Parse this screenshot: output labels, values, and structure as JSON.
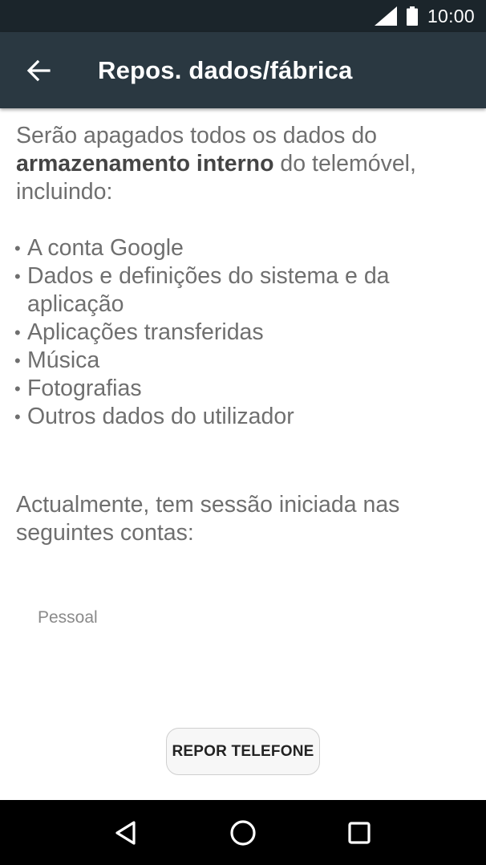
{
  "status_bar": {
    "time": "10:00",
    "icons": [
      "signal-icon",
      "battery-icon"
    ]
  },
  "app_bar": {
    "title": "Repos. dados/fábrica",
    "back_icon": "back-arrow-icon",
    "background": "#2a3841"
  },
  "content": {
    "intro_prefix": "Serão apagados todos os dados do ",
    "intro_bold": "armazenamento interno",
    "intro_suffix": " do telemóvel, incluindo:",
    "items": [
      "A conta Google",
      "Dados e definições do sistema e da aplicação",
      "Aplicações transferidas",
      "Música",
      "Fotografias",
      "Outros dados do utilizador"
    ],
    "accounts_intro": "Actualmente, tem sessão iniciada nas seguintes contas:",
    "account_label": "Pessoal"
  },
  "actions": {
    "reset_label": "REPOR TELEFONE"
  },
  "nav_bar": {
    "icons": [
      "nav-back-icon",
      "nav-home-icon",
      "nav-recents-icon"
    ]
  }
}
